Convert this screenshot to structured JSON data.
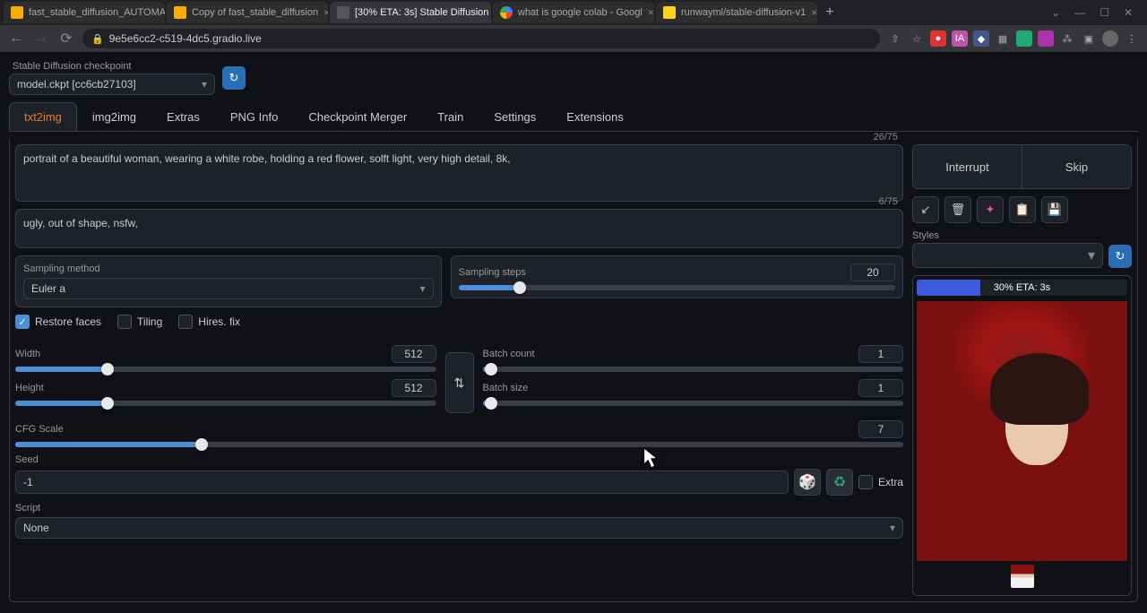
{
  "browser": {
    "tabs": [
      {
        "title": "fast_stable_diffusion_AUTOMA"
      },
      {
        "title": "Copy of fast_stable_diffusion"
      },
      {
        "title": "[30% ETA: 3s] Stable Diffusion"
      },
      {
        "title": "what is google colab - Googl"
      },
      {
        "title": "runwayml/stable-diffusion-v1"
      }
    ],
    "url": "9e5e6cc2-c519-4dc5.gradio.live"
  },
  "checkpoint": {
    "label": "Stable Diffusion checkpoint",
    "value": "model.ckpt [cc6cb27103]"
  },
  "tabs": [
    "txt2img",
    "img2img",
    "Extras",
    "PNG Info",
    "Checkpoint Merger",
    "Train",
    "Settings",
    "Extensions"
  ],
  "prompt": {
    "positive": "portrait of a beautiful woman, wearing a white robe, holding a red flower, solft light, very high detail, 8k,",
    "positive_count": "26/75",
    "negative": "ugly, out of shape, nsfw,",
    "negative_count": "6/75"
  },
  "actions": {
    "interrupt": "Interrupt",
    "skip": "Skip"
  },
  "styles_label": "Styles",
  "sampling": {
    "method_label": "Sampling method",
    "method_value": "Euler a",
    "steps_label": "Sampling steps",
    "steps_value": "20"
  },
  "checks": {
    "restore_faces": "Restore faces",
    "tiling": "Tiling",
    "hires_fix": "Hires. fix"
  },
  "dims": {
    "width_label": "Width",
    "width_value": "512",
    "height_label": "Height",
    "height_value": "512"
  },
  "batch": {
    "count_label": "Batch count",
    "count_value": "1",
    "size_label": "Batch size",
    "size_value": "1"
  },
  "cfg": {
    "label": "CFG Scale",
    "value": "7"
  },
  "seed": {
    "label": "Seed",
    "value": "-1",
    "extra_label": "Extra"
  },
  "script": {
    "label": "Script",
    "value": "None"
  },
  "progress": {
    "text": "30% ETA: 3s",
    "percent": 30
  }
}
